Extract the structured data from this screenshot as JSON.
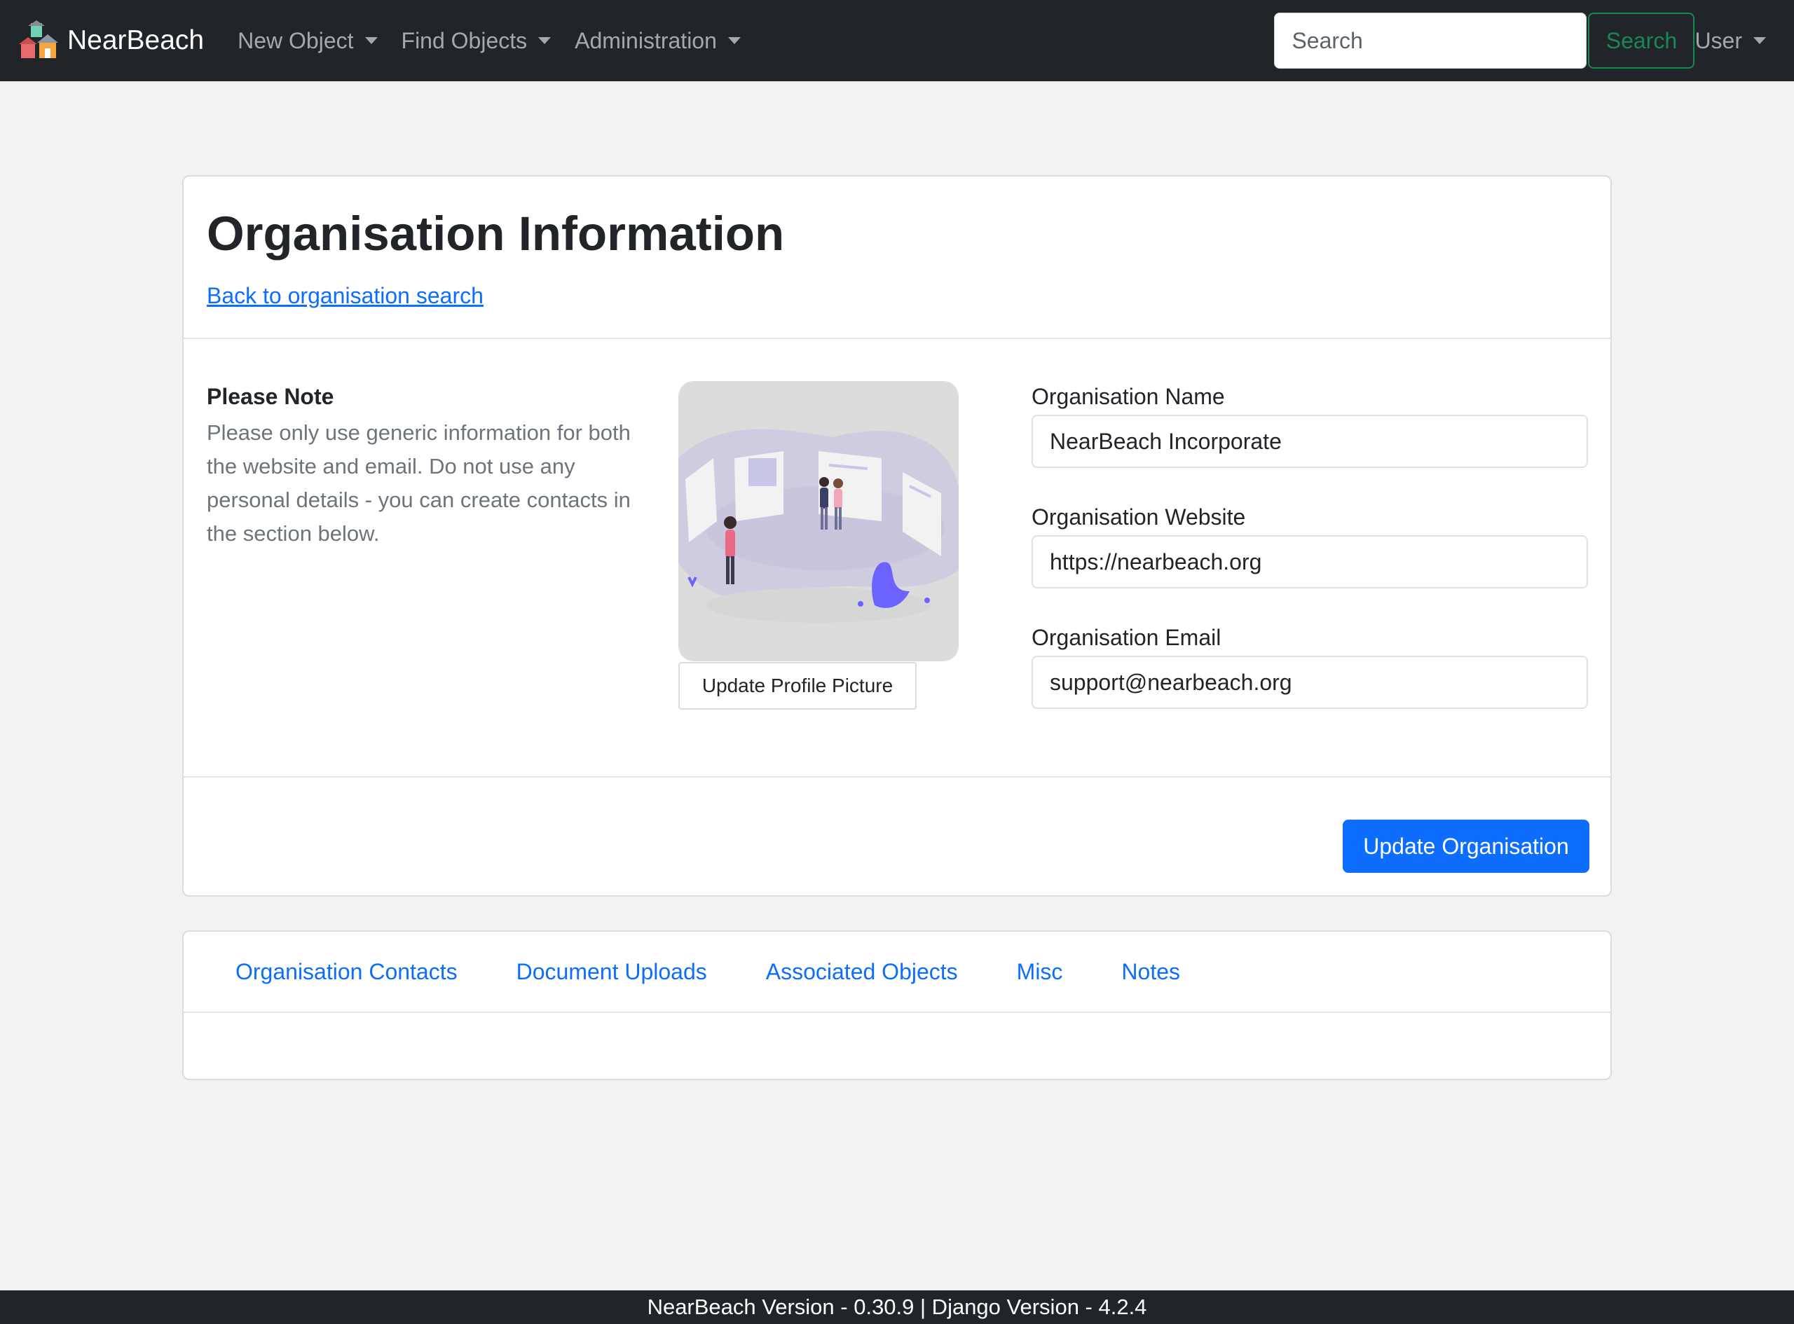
{
  "navbar": {
    "brand": "NearBeach",
    "menus": [
      {
        "label": "New Object"
      },
      {
        "label": "Find Objects"
      },
      {
        "label": "Administration"
      }
    ],
    "search_placeholder": "Search",
    "search_button": "Search",
    "user_menu": "User"
  },
  "organisation": {
    "title": "Organisation Information",
    "back_link": "Back to organisation search",
    "note_title": "Please Note",
    "note_text": "Please only use generic information for both the website and email. Do not use any personal details - you can create contacts in the section below.",
    "update_picture_label": "Update Profile Picture",
    "fields": {
      "name": {
        "label": "Organisation Name",
        "value": "NearBeach Incorporate"
      },
      "website": {
        "label": "Organisation Website",
        "value": "https://nearbeach.org"
      },
      "email": {
        "label": "Organisation Email",
        "value": "support@nearbeach.org"
      }
    },
    "update_button": "Update Organisation"
  },
  "tabs": [
    {
      "label": "Organisation Contacts"
    },
    {
      "label": "Document Uploads"
    },
    {
      "label": "Associated Objects"
    },
    {
      "label": "Misc"
    },
    {
      "label": "Notes"
    }
  ],
  "footer": {
    "text": "NearBeach Version - 0.30.9 | Django Version - 4.2.4"
  },
  "colors": {
    "navbar_bg": "#212529",
    "primary": "#0d6efd",
    "success": "#198754",
    "page_bg": "#f3f2f2"
  }
}
